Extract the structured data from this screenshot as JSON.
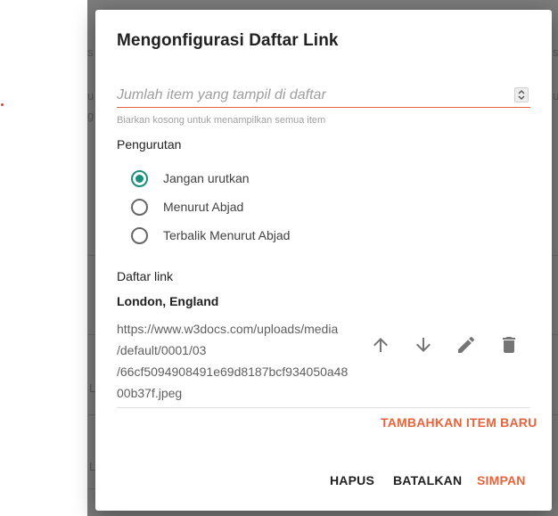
{
  "background": {
    "fragments": [
      "s",
      "u",
      "g",
      "L",
      "L"
    ],
    "right_fragments": [
      "s",
      "u"
    ]
  },
  "dialog": {
    "title": "Mengonfigurasi Daftar Link",
    "count_input": {
      "placeholder": "Jumlah item yang tampil di daftar",
      "value": ""
    },
    "count_hint": "Biarkan kosong untuk menampilkan semua item",
    "sorting": {
      "label": "Pengurutan",
      "options": [
        {
          "label": "Jangan urutkan",
          "checked": true
        },
        {
          "label": "Menurut Abjad",
          "checked": false
        },
        {
          "label": "Terbalik Menurut Abjad",
          "checked": false
        }
      ]
    },
    "links": {
      "label": "Daftar link",
      "items": [
        {
          "name": "London, England",
          "url_lines": [
            "https://www.w3docs.com/uploads/media",
            "/default/0001/03",
            "/66cf5094908491e69d8187bcf934050a48",
            "00b37f.jpeg"
          ]
        }
      ]
    },
    "add_item_label": "TAMBAHKAN ITEM BARU",
    "buttons": {
      "delete": "HAPUS",
      "cancel": "BATALKAN",
      "save": "SIMPAN"
    },
    "colors": {
      "accent": "#e6643c",
      "radio_checked": "#1a8f7a"
    }
  },
  "icons": [
    "arrow-up-icon",
    "arrow-down-icon",
    "edit-icon",
    "delete-icon"
  ]
}
